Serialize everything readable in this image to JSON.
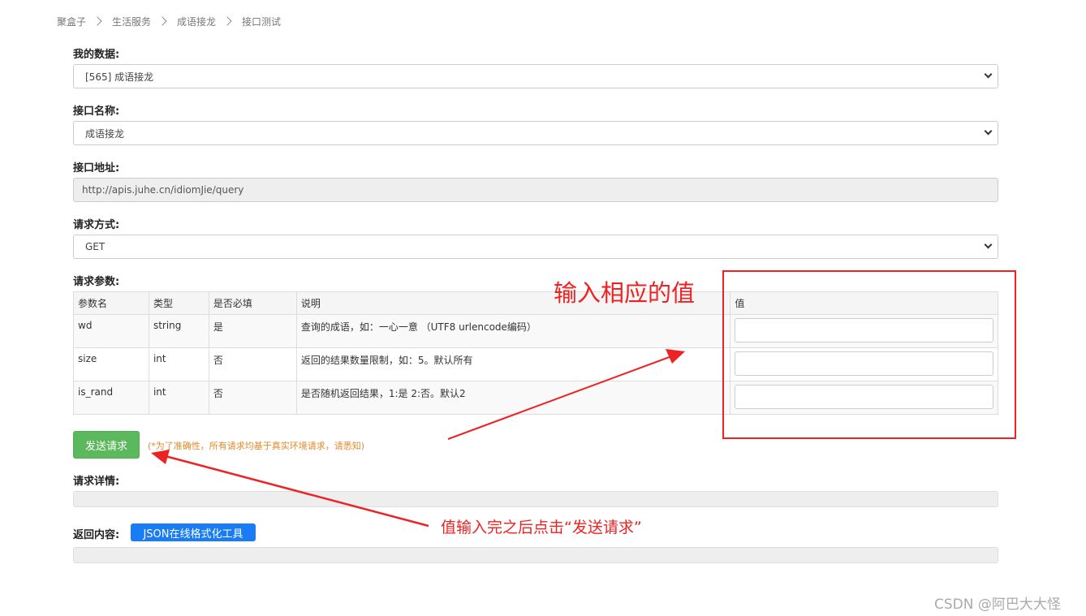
{
  "breadcrumb": [
    "聚盒子",
    "生活服务",
    "成语接龙",
    "接口测试"
  ],
  "fields": {
    "my_data": {
      "label": "我的数据:",
      "selected": "[565] 成语接龙"
    },
    "api_name": {
      "label": "接口名称:",
      "selected": "成语接龙"
    },
    "api_url": {
      "label": "接口地址:",
      "value": "http://apis.juhe.cn/idiomJie/query"
    },
    "method": {
      "label": "请求方式:",
      "selected": "GET"
    }
  },
  "params": {
    "label": "请求参数:",
    "headers": [
      "参数名",
      "类型",
      "是否必填",
      "说明",
      "值"
    ],
    "rows": [
      {
        "name": "wd",
        "type": "string",
        "required": "是",
        "desc": "查询的成语，如：一心一意 （UTF8 urlencode编码）",
        "value": ""
      },
      {
        "name": "size",
        "type": "int",
        "required": "否",
        "desc": "返回的结果数量限制，如：5。默认所有",
        "value": ""
      },
      {
        "name": "is_rand",
        "type": "int",
        "required": "否",
        "desc": "是否随机返回结果，1:是 2:否。默认2",
        "value": ""
      }
    ]
  },
  "send": {
    "label": "发送请求",
    "note": "(*为了准确性，所有请求均基于真实环境请求，请悉知)"
  },
  "request_detail": {
    "label": "请求详情:"
  },
  "response": {
    "label": "返回内容:",
    "json_tool": "JSON在线格式化工具"
  },
  "annotations": {
    "input_hint": "输入相应的值",
    "send_hint": "值输入完之后点击“发送请求”",
    "color": "#ee2222"
  },
  "watermark": "CSDN @阿巴大大怪",
  "colors": {
    "send_button": "#5cb85c",
    "json_button": "#1a7cf5",
    "note": "#e08a2c"
  }
}
